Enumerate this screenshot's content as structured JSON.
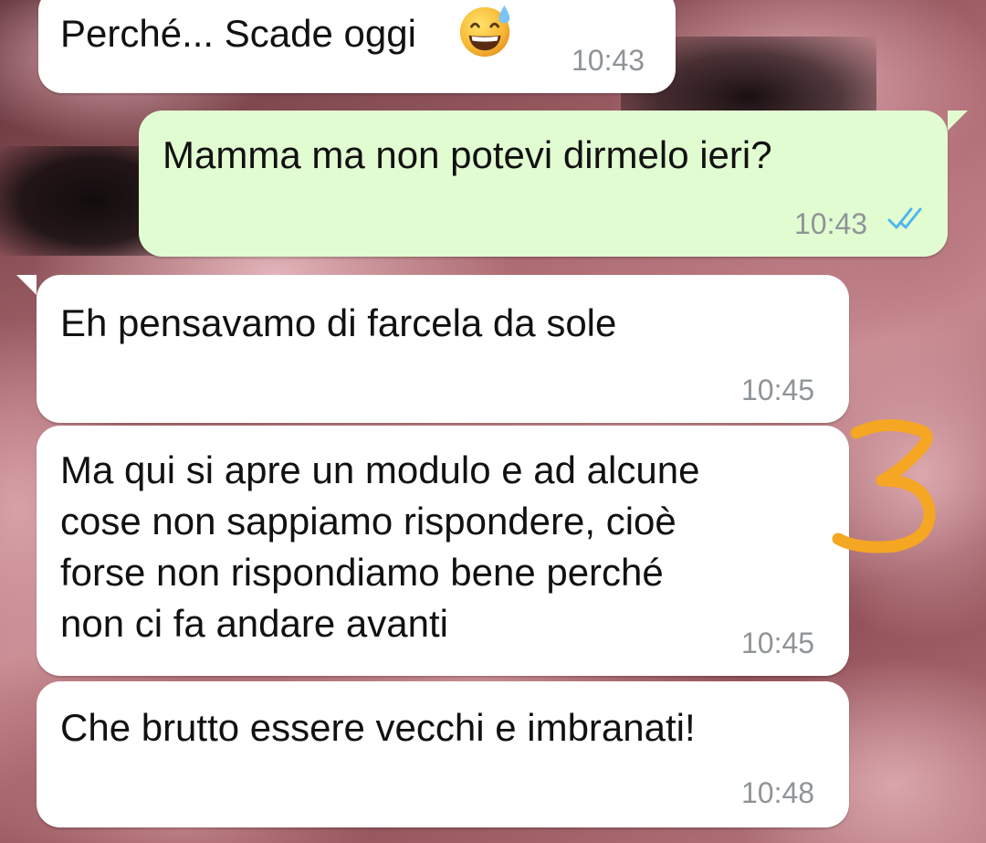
{
  "messages": [
    {
      "direction": "incoming",
      "text": "Perché... Scade oggi",
      "emoji": "grinning-face-with-sweat",
      "time": "10:43"
    },
    {
      "direction": "outgoing",
      "text": "Mamma ma non potevi dirmelo ieri?",
      "time": "10:43",
      "status": "read"
    },
    {
      "direction": "incoming",
      "text": "Eh pensavamo di farcela da sole",
      "time": "10:45"
    },
    {
      "direction": "incoming",
      "lines": [
        "Ma qui si apre un modulo e ad alcune",
        "cose non sappiamo rispondere, cioè",
        "forse non rispondiamo bene perché",
        "non ci fa andare avanti"
      ],
      "time": "10:45"
    },
    {
      "direction": "incoming",
      "text": "Che brutto essere vecchi e imbranati!",
      "time": "10:48"
    }
  ],
  "annotation": {
    "text": "3",
    "color": "#f5a623"
  },
  "colors": {
    "incoming_bubble": "#ffffff",
    "outgoing_bubble": "#e2fcd2",
    "timestamp": "#8f9498",
    "read_ticks": "#4fb6ec"
  }
}
